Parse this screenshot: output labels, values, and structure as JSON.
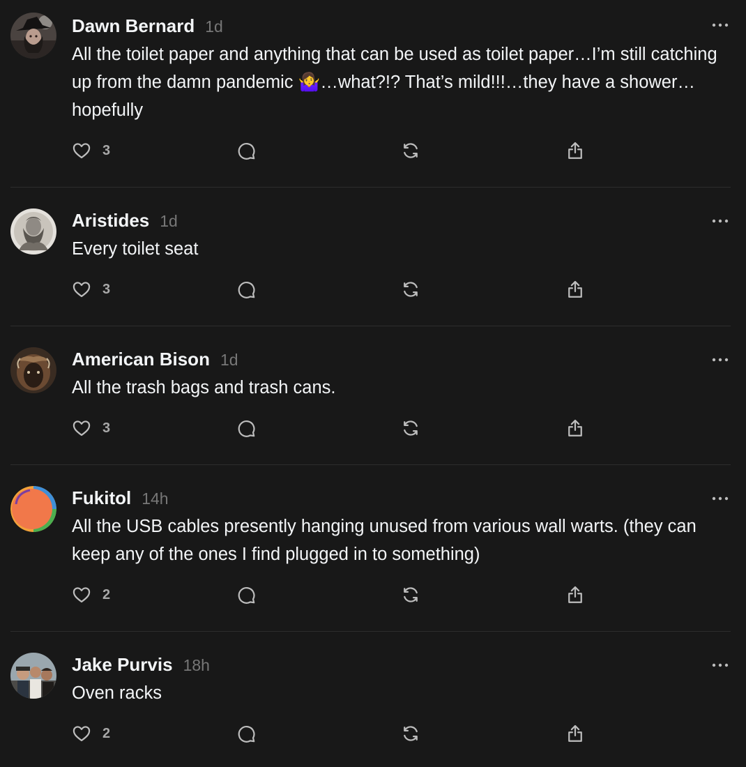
{
  "feed": {
    "posts": [
      {
        "username": "Dawn Bernard",
        "timestamp": "1d",
        "text": "All the toilet paper and anything that can be used as toilet paper…I’m still catching up from the damn pandemic 🤷‍♀️…what?!? That’s mild!!!…they have a shower…hopefully",
        "like_count": "3",
        "avatar": "dark-hat-portrait"
      },
      {
        "username": "Aristides",
        "timestamp": "1d",
        "text": "Every toilet seat",
        "like_count": "3",
        "avatar": "marble-statue-bust"
      },
      {
        "username": "American Bison",
        "timestamp": "1d",
        "text": "All the trash bags and trash cans.",
        "like_count": "3",
        "avatar": "bison-head"
      },
      {
        "username": "Fukitol",
        "timestamp": "14h",
        "text": "All the USB cables presently hanging unused from various wall warts. (they can keep any of the ones I find plugged in to something)",
        "like_count": "2",
        "avatar": "orange-circle-logo"
      },
      {
        "username": "Jake Purvis",
        "timestamp": "18h",
        "text": "Oven racks",
        "like_count": "2",
        "avatar": "group-photo"
      }
    ]
  },
  "icons": {
    "like": "heart-icon",
    "comment": "comment-bubble-icon",
    "repost": "repost-icon",
    "share": "share-icon",
    "more": "more-options-icon"
  },
  "colors": {
    "background": "#181818",
    "primary_text": "#f3f5f7",
    "secondary_text": "#777777",
    "divider": "#2d2d2d"
  }
}
